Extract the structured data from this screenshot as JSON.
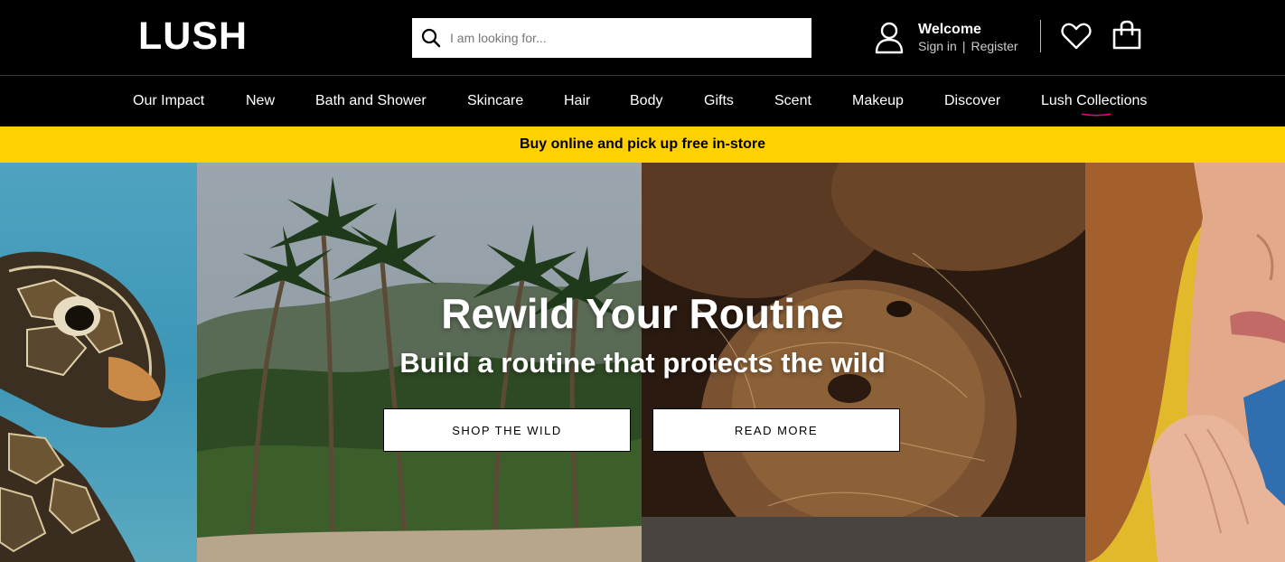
{
  "brand": {
    "logo_text": "LUSH"
  },
  "search": {
    "placeholder": "I am looking for...",
    "value": "",
    "icon": "search-icon"
  },
  "account": {
    "welcome": "Welcome",
    "sign_in": "Sign in",
    "separator": "|",
    "register": "Register",
    "icon": "user-icon"
  },
  "actions": {
    "wishlist_icon": "heart-icon",
    "cart_icon": "shopping-bag-icon"
  },
  "nav": {
    "items": [
      {
        "label": "Our Impact"
      },
      {
        "label": "New"
      },
      {
        "label": "Bath and Shower"
      },
      {
        "label": "Skincare"
      },
      {
        "label": "Hair"
      },
      {
        "label": "Body"
      },
      {
        "label": "Gifts"
      },
      {
        "label": "Scent"
      },
      {
        "label": "Makeup"
      },
      {
        "label": "Discover"
      },
      {
        "label": "Lush Collections"
      }
    ],
    "active_index": 10,
    "active_underline_color": "#e6007e"
  },
  "promo_banner": {
    "text": "Buy online and pick up free in-store",
    "background": "#ffd100"
  },
  "hero": {
    "title": "Rewild Your Routine",
    "subtitle": "Build a routine that protects the wild",
    "primary_button": "SHOP THE WILD",
    "secondary_button": "READ MORE"
  },
  "colors": {
    "header_bg": "#000000",
    "banner_yellow": "#ffd100",
    "accent_pink": "#e6007e"
  }
}
